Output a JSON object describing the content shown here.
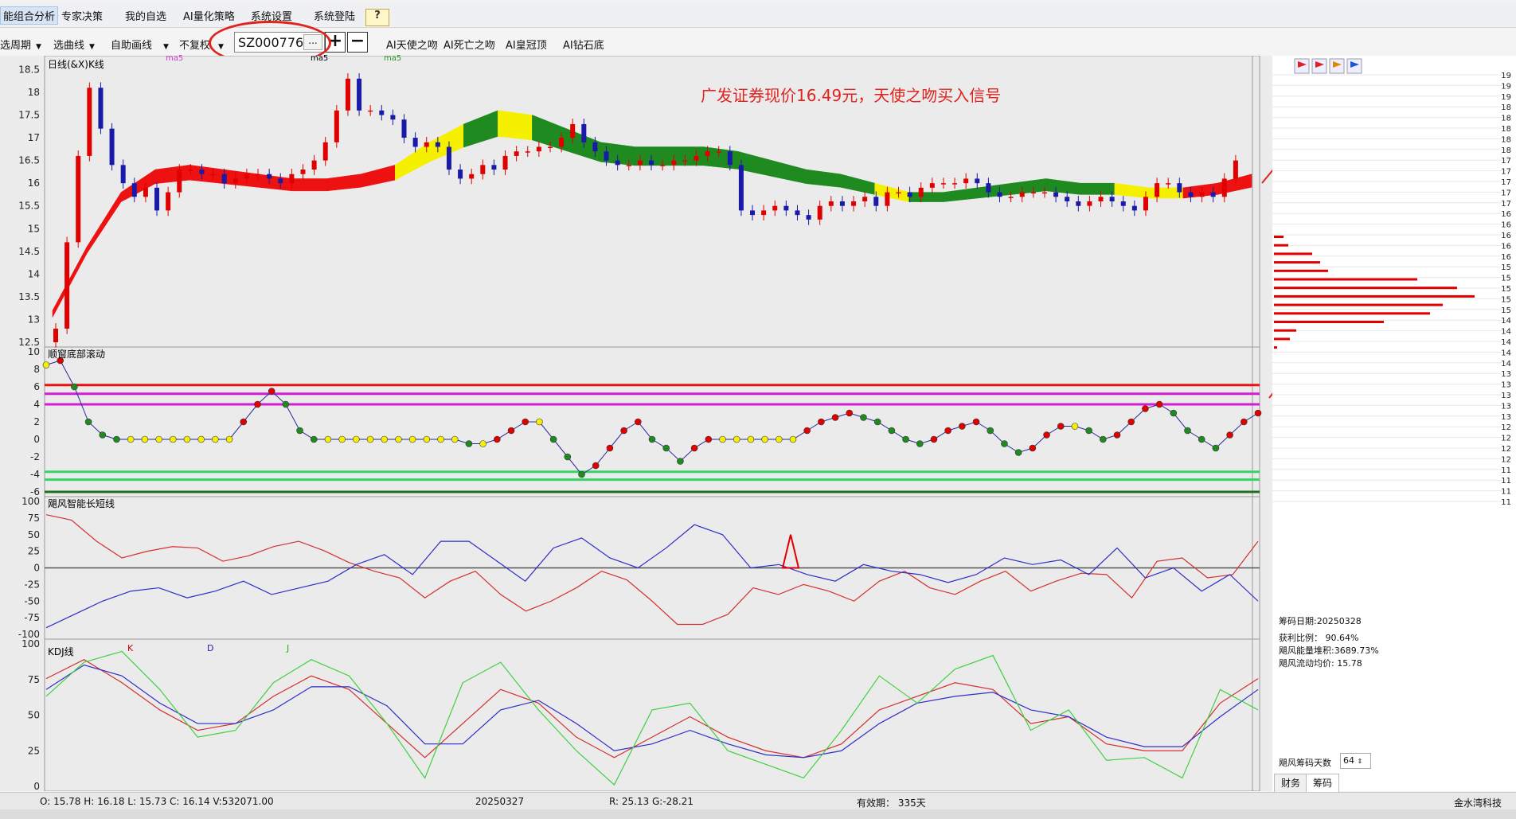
{
  "menu": {
    "items": [
      "能组合分析",
      "专家决策",
      "我的自选",
      "AI量化策略",
      "系统设置",
      "系统登陆"
    ],
    "help": "?"
  },
  "toolbar": {
    "period": "选周期",
    "curve": "选曲线",
    "draw": "自助画线",
    "fq": "不复权",
    "code": "SZ000776",
    "dots": "...",
    "plus": "+",
    "minus": "−",
    "ai_buttons": [
      "AI天使之吻",
      "AI死亡之吻",
      "AI皇冠顶",
      "AI钻石底"
    ]
  },
  "panels": {
    "kline_title": "日线(&X)K线",
    "ma_label": "ma5",
    "osc_title": "顺窗底部滚动",
    "long_short_title": "飓风智能长短线",
    "kdj_title": "KDJ线",
    "kdj_k": "K",
    "kdj_d": "D",
    "kdj_j": "J"
  },
  "annotation": "广发证券现价16.49元，天使之吻买入信号",
  "right_info": {
    "date": "筹码日期:20250328",
    "profit": "获利比例： 90.64%",
    "energy": "飓风能量堆积:3689.73%",
    "avg": "飓风流动均价: 15.78",
    "days_label": "飓风筹码天数",
    "days_value": "64",
    "tabs": [
      "财务",
      "筹码"
    ]
  },
  "status": {
    "ohlc": "O: 15.78  H: 16.18  L: 15.73  C: 16.14  V:532071.00",
    "date": "20250327",
    "rg": "R: 25.13  G:-28.21",
    "valid": "有效期：  335天",
    "brand": "金水湾科技"
  },
  "chart_data": [
    {
      "type": "candlestick",
      "title": "日线(&X)K线",
      "ylim": [
        12.5,
        18.7
      ],
      "yticks": [
        "18.5",
        "18",
        "17.5",
        "17",
        "16.5",
        "16",
        "15.5",
        "15",
        "14.5",
        "14",
        "13.5",
        "13",
        "12.5"
      ],
      "close": [
        12.8,
        14.7,
        16.6,
        18.1,
        17.2,
        16.4,
        16.0,
        15.7,
        15.9,
        15.4,
        15.8,
        16.3,
        16.3,
        16.2,
        16.2,
        16.0,
        16.1,
        16.2,
        16.2,
        16.1,
        16.0,
        16.2,
        16.3,
        16.5,
        16.9,
        17.6,
        18.3,
        17.6,
        17.6,
        17.5,
        17.4,
        17.0,
        16.8,
        16.9,
        16.8,
        16.3,
        16.1,
        16.2,
        16.4,
        16.3,
        16.6,
        16.7,
        16.7,
        16.8,
        16.8,
        17.0,
        17.3,
        16.9,
        16.7,
        16.5,
        16.4,
        16.4,
        16.5,
        16.4,
        16.4,
        16.5,
        16.5,
        16.6,
        16.7,
        16.7,
        16.4,
        15.4,
        15.3,
        15.4,
        15.5,
        15.4,
        15.3,
        15.2,
        15.5,
        15.6,
        15.5,
        15.6,
        15.7,
        15.5,
        15.8,
        15.8,
        15.7,
        15.9,
        16.0,
        16.0,
        16.0,
        16.1,
        16.0,
        15.8,
        15.7,
        15.7,
        15.8,
        15.8,
        15.8,
        15.7,
        15.6,
        15.5,
        15.6,
        15.7,
        15.6,
        15.5,
        15.4,
        15.7,
        16.0,
        16.0,
        15.8,
        15.7,
        15.8,
        15.7,
        16.1,
        16.5
      ],
      "ma_band_upper": [
        13.2,
        14.6,
        15.8,
        16.3,
        16.4,
        16.3,
        16.2,
        16.1,
        16.1,
        16.2,
        16.4,
        16.9,
        17.3,
        17.6,
        17.5,
        17.2,
        16.9,
        16.8,
        16.8,
        16.8,
        16.7,
        16.5,
        16.3,
        16.2,
        16.0,
        15.8,
        15.8,
        15.9,
        16.0,
        16.1,
        16.0,
        16.0,
        15.9,
        15.9,
        16.0,
        16.2
      ],
      "annotation": "广发证券现价16.49元，天使之吻买入信号"
    },
    {
      "type": "line",
      "title": "顺窗底部滚动",
      "ylim": [
        -6,
        10
      ],
      "yticks": [
        "10",
        "8",
        "6",
        "4",
        "2",
        "0",
        "-2",
        "-4",
        "-6"
      ],
      "hlines": [
        6.2,
        5.2,
        4.0,
        -3.7,
        -4.6,
        -6
      ]
    },
    {
      "type": "line",
      "title": "飓风智能长短线",
      "ylim": [
        -100,
        100
      ],
      "yticks": [
        "100",
        "75",
        "50",
        "25",
        "0",
        "-25",
        "-50",
        "-75",
        "-100"
      ],
      "series": [
        {
          "values": [
            80,
            72,
            40,
            15,
            25,
            32,
            30,
            10,
            18,
            32,
            40,
            26,
            8,
            -5,
            -15,
            -45,
            -20,
            -5,
            -40,
            -65,
            -50,
            -30,
            -5,
            -18,
            -50,
            -85,
            -85,
            -70,
            -30,
            -40,
            -25,
            -35,
            -50,
            -20,
            -5,
            -30,
            -40,
            -20,
            -5,
            -35,
            -20,
            -8,
            -10,
            -45,
            10,
            15,
            -15,
            -10,
            40
          ]
        },
        {
          "values": [
            -90,
            -70,
            -50,
            -35,
            -30,
            -45,
            -35,
            -20,
            -40,
            -30,
            -20,
            5,
            20,
            -10,
            40,
            40,
            10,
            -20,
            30,
            45,
            15,
            0,
            30,
            65,
            50,
            0,
            5,
            -10,
            -20,
            5,
            -5,
            -10,
            -22,
            -10,
            15,
            5,
            12,
            -10,
            30,
            -15,
            0,
            -35,
            -10,
            -50
          ]
        }
      ]
    },
    {
      "type": "line",
      "title": "KDJ线",
      "ylim": [
        0,
        100
      ],
      "yticks": [
        "100",
        "75",
        "50",
        "25",
        "0"
      ],
      "series": [
        {
          "name": "K",
          "values": [
            78,
            92,
            75,
            55,
            40,
            45,
            65,
            80,
            70,
            45,
            20,
            45,
            70,
            60,
            35,
            20,
            35,
            50,
            35,
            25,
            20,
            30,
            55,
            65,
            75,
            70,
            45,
            50,
            30,
            25,
            25,
            60,
            78
          ]
        },
        {
          "name": "D",
          "values": [
            70,
            88,
            80,
            60,
            45,
            45,
            55,
            72,
            72,
            58,
            30,
            30,
            55,
            62,
            45,
            25,
            30,
            40,
            30,
            22,
            20,
            25,
            45,
            60,
            65,
            68,
            55,
            50,
            35,
            28,
            28,
            50,
            70
          ]
        },
        {
          "name": "J",
          "values": [
            65,
            90,
            98,
            70,
            35,
            40,
            75,
            92,
            80,
            45,
            5,
            75,
            90,
            55,
            25,
            0,
            55,
            60,
            25,
            15,
            5,
            40,
            80,
            60,
            85,
            95,
            40,
            55,
            18,
            20,
            5,
            70,
            55
          ]
        }
      ]
    }
  ]
}
